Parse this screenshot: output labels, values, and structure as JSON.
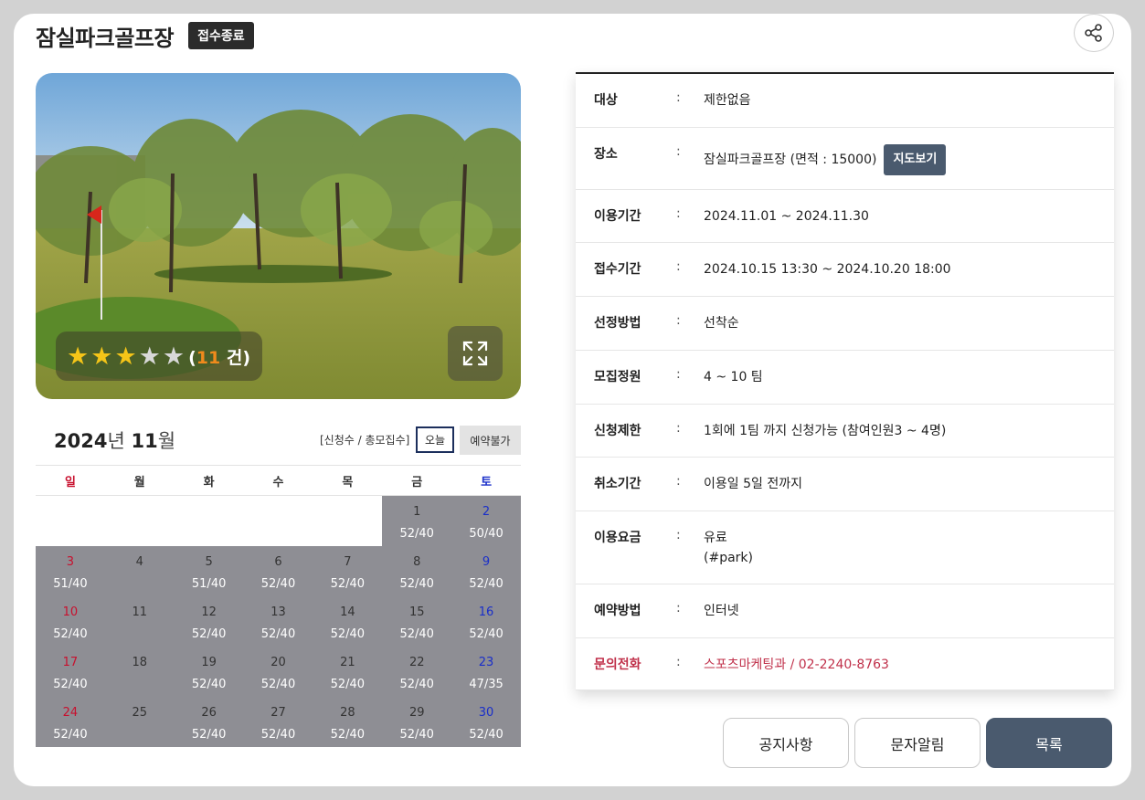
{
  "header": {
    "title": "잠실파크골프장",
    "status": "접수종료"
  },
  "icons": {
    "share": "share-icon",
    "fullscreen": "expand-icon",
    "star": "star-icon"
  },
  "rating": {
    "score": 3,
    "max": 5,
    "count_prefix": "(",
    "count": "11",
    "count_suffix": " 건)"
  },
  "calendar": {
    "year": "2024",
    "year_unit": "년",
    "month": "11",
    "month_unit": "월",
    "legend": "[신청수 / 총모집수]",
    "today_label": "오늘",
    "unavailable_label": "예약불가",
    "weekdays": [
      "일",
      "월",
      "화",
      "수",
      "목",
      "금",
      "토"
    ],
    "days": [
      {
        "d": "",
        "c": ""
      },
      {
        "d": "",
        "c": ""
      },
      {
        "d": "",
        "c": ""
      },
      {
        "d": "",
        "c": ""
      },
      {
        "d": "",
        "c": ""
      },
      {
        "d": "1",
        "c": "52/40"
      },
      {
        "d": "2",
        "c": "50/40"
      },
      {
        "d": "3",
        "c": "51/40"
      },
      {
        "d": "4",
        "c": ""
      },
      {
        "d": "5",
        "c": "51/40"
      },
      {
        "d": "6",
        "c": "52/40"
      },
      {
        "d": "7",
        "c": "52/40"
      },
      {
        "d": "8",
        "c": "52/40"
      },
      {
        "d": "9",
        "c": "52/40"
      },
      {
        "d": "10",
        "c": "52/40"
      },
      {
        "d": "11",
        "c": ""
      },
      {
        "d": "12",
        "c": "52/40"
      },
      {
        "d": "13",
        "c": "52/40"
      },
      {
        "d": "14",
        "c": "52/40"
      },
      {
        "d": "15",
        "c": "52/40"
      },
      {
        "d": "16",
        "c": "52/40"
      },
      {
        "d": "17",
        "c": "52/40"
      },
      {
        "d": "18",
        "c": ""
      },
      {
        "d": "19",
        "c": "52/40"
      },
      {
        "d": "20",
        "c": "52/40"
      },
      {
        "d": "21",
        "c": "52/40"
      },
      {
        "d": "22",
        "c": "52/40"
      },
      {
        "d": "23",
        "c": "47/35"
      },
      {
        "d": "24",
        "c": "52/40"
      },
      {
        "d": "25",
        "c": ""
      },
      {
        "d": "26",
        "c": "52/40"
      },
      {
        "d": "27",
        "c": "52/40"
      },
      {
        "d": "28",
        "c": "52/40"
      },
      {
        "d": "29",
        "c": "52/40"
      },
      {
        "d": "30",
        "c": "52/40"
      }
    ]
  },
  "info": {
    "colon": ":",
    "map_button": "지도보기",
    "rows": [
      {
        "label": "대상",
        "value": "제한없음"
      },
      {
        "label": "장소",
        "value": "잠실파크골프장 (면적 : 15000)"
      },
      {
        "label": "이용기간",
        "value": "2024.11.01 ~ 2024.11.30"
      },
      {
        "label": "접수기간",
        "value": "2024.10.15 13:30 ~ 2024.10.20 18:00"
      },
      {
        "label": "선정방법",
        "value": "선착순"
      },
      {
        "label": "모집정원",
        "value": "4 ~ 10 팀"
      },
      {
        "label": "신청제한",
        "value": "1회에 1팀 까지 신청가능 (참여인원3 ~ 4명)"
      },
      {
        "label": "취소기간",
        "value": "이용일 5일 전까지"
      },
      {
        "label": "이용요금",
        "value": "유료",
        "value2": "(#park)"
      },
      {
        "label": "예약방법",
        "value": "인터넷"
      },
      {
        "label": "문의전화",
        "value": "스포츠마케팅과 / 02-2240-8763"
      }
    ]
  },
  "buttons": {
    "notice": "공지사항",
    "sms": "문자알림",
    "list": "목록"
  },
  "colors": {
    "badge": "#2b2b2b",
    "primary": "#4a5a6e",
    "calendar_fill": "#8e8e94",
    "sunday": "#c8102e",
    "saturday": "#1a2fc9",
    "contact": "#c0304a",
    "star": "#f5c518"
  }
}
